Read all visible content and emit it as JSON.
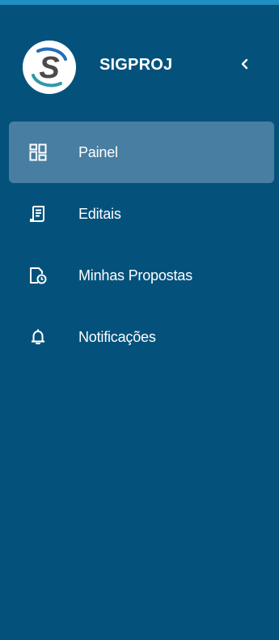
{
  "brand": {
    "name": "SIGPROJ",
    "logo_icon": "sigproj-logo-icon",
    "collapse_icon": "chevron-left-icon"
  },
  "colors": {
    "sidebar_bg": "#04527c",
    "top_strip": "#1f8fc4",
    "active_item_bg": "#477ea1",
    "text": "#ffffff"
  },
  "nav": {
    "items": [
      {
        "label": "Painel",
        "icon": "dashboard-icon",
        "active": true
      },
      {
        "label": "Editais",
        "icon": "document-icon",
        "active": false
      },
      {
        "label": "Minhas Propostas",
        "icon": "proposal-clock-icon",
        "active": false
      },
      {
        "label": "Notificações",
        "icon": "bell-icon",
        "active": false
      }
    ]
  }
}
